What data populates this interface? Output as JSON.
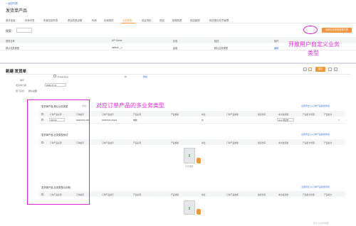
{
  "top": {
    "back_link": "< 返回列表",
    "title": "发货单产品",
    "tabs": [
      "基本信息",
      "布局列表",
      "布局控制列表",
      "角色权限设置",
      "布局",
      "布局规则",
      "业务类型",
      "验证规则",
      "按钮",
      "数据权限",
      "按钮管理",
      "相关团队成员管理"
    ],
    "active_tab": "业务类型",
    "search_label": "搜索：",
    "right_button": "启用业务类型选择列表",
    "table_headers": [
      "类型名称",
      "API Name",
      "状态",
      "描述",
      "操作"
    ],
    "table_row": [
      "默认业务类型",
      "default__c",
      "启用",
      "默认业务类型",
      "编辑"
    ]
  },
  "bottom": {
    "title": "新建 发货单",
    "label_code": "单号",
    "label_date": "发货单日期",
    "date_value": "2020-07-01",
    "label_owner": "部门名称",
    "owner_value": "默认总部",
    "image_file": "image.jpeg",
    "file_size": "kb",
    "delete_link": "删除",
    "save_button": "保存",
    "sections": [
      {
        "title": "发货单产品-默认业务类型",
        "tag": "添加",
        "actions": "全部导出   从订单产品批量添加"
      },
      {
        "title": "发货单产品-业务类型测试",
        "tag": "",
        "actions": "全部导出   从订单产品批量添加"
      },
      {
        "title": "发货单产品-业务类型2(示例)",
        "tag": "",
        "actions": "全部导出   从订单产品批量添加"
      }
    ],
    "grid_headers": [
      "订单产品名称",
      "订单编号",
      "订单产品编号",
      "产品名称",
      "产品规格",
      "单位",
      "订单产品数量",
      "发货仓库",
      "本次发货数",
      "产品批次管理",
      "产品批次"
    ],
    "row1": [
      "220.00",
      "20200701-0001",
      "20200701-00123",
      "电脑",
      "",
      "台",
      "",
      "",
      "ema 测试仓",
      "",
      ""
    ],
    "empty_text": "暂无数据",
    "watermark": "知乎 @纷享销客"
  },
  "annotations": {
    "top_note_line1": "开放用户自定义业务",
    "top_note_line2": "类型",
    "middle_note": "对应订单产品的多业务类型"
  },
  "colors": {
    "accent": "#f0963c",
    "link": "#3d7bd9",
    "annotation": "#e02bd6"
  }
}
